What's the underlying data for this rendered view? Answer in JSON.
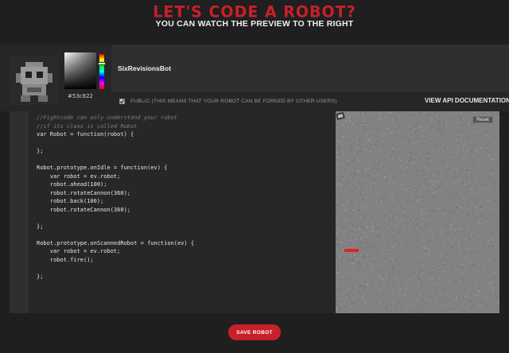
{
  "header": {
    "title": "LET'S CODE A ROBOT?",
    "subtitle": "YOU CAN WATCH THE PREVIEW TO THE RIGHT"
  },
  "config": {
    "color_hex": "#53c822",
    "robot_name": "SixRevisionsBot",
    "public_text": "PUBLIC (THIS MEANS THAT YOUR ROBOT CAN BE FORKED BY OTHER USERS)",
    "public_checked": true,
    "api_link": "VIEW API DOCUMENTATION"
  },
  "editor": {
    "lines": [
      {
        "text": "//Fightcode can only understand your robot",
        "type": "comment"
      },
      {
        "text": "//if its class is called Robot",
        "type": "comment"
      },
      {
        "text": "var Robot = function(robot) {",
        "type": "code"
      },
      {
        "text": "",
        "type": "code"
      },
      {
        "text": "};",
        "type": "code"
      },
      {
        "text": "",
        "type": "code"
      },
      {
        "text": "Robot.prototype.onIdle = function(ev) {",
        "type": "code"
      },
      {
        "text": "    var robot = ev.robot;",
        "type": "code"
      },
      {
        "text": "    robot.ahead(100);",
        "type": "code"
      },
      {
        "text": "    robot.rotateCannon(360);",
        "type": "code"
      },
      {
        "text": "    robot.back(100);",
        "type": "code"
      },
      {
        "text": "    robot.rotateCannon(360);",
        "type": "code"
      },
      {
        "text": "",
        "type": "code"
      },
      {
        "text": "};",
        "type": "code"
      },
      {
        "text": "",
        "type": "code"
      },
      {
        "text": "Robot.prototype.onScannedRobot = function(ev) {",
        "type": "code"
      },
      {
        "text": "    var robot = ev.robot;",
        "type": "code"
      },
      {
        "text": "    robot.fire();",
        "type": "code"
      },
      {
        "text": "",
        "type": "code"
      },
      {
        "text": "};",
        "type": "code"
      }
    ]
  },
  "preview": {
    "reset_label": "Reset"
  },
  "footer": {
    "save_label": "SAVE ROBOT"
  }
}
